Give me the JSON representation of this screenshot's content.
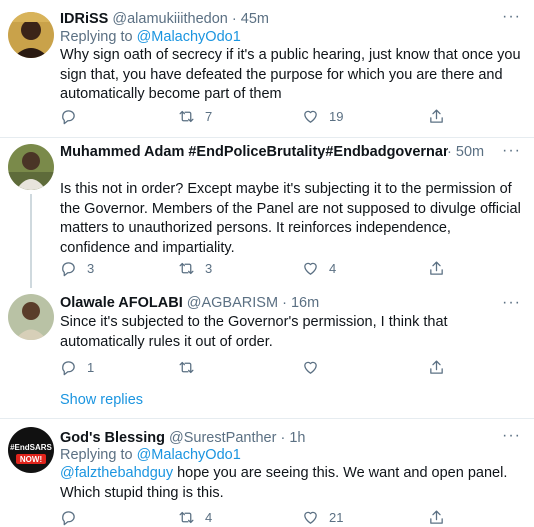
{
  "tweets": [
    {
      "name": "IDRiSS",
      "handle": "@alamukiiithedon",
      "time": "45m",
      "replying_label": "Replying to",
      "replying_to": "@MalachyOdo1",
      "text": "Why sign oath of secrecy if it's a public hearing, just know that once you sign that, you have defeated the purpose for which you are there and automatically become part of them",
      "replies": "",
      "retweets": "7",
      "likes": "19"
    },
    {
      "name": "Muhammed Adam #EndPoliceBrutality#Endbadgovernance",
      "handle": "@",
      "time": "50m",
      "text": "Is this not in order? Except maybe it's subjecting it to the permission of the Governor. Members of the Panel are not supposed to divulge official matters to unauthorized persons. It reinforces independence, confidence and impartiality.",
      "replies": "3",
      "retweets": "3",
      "likes": "4"
    },
    {
      "name": "Olawale AFOLABI",
      "handle": "@AGBARISM",
      "time": "16m",
      "text": "Since it's subjected to the Governor's permission, I think that automatically rules it out of order.",
      "replies": "1",
      "retweets": "",
      "likes": ""
    },
    {
      "name": "God's Blessing",
      "handle": "@SurestPanther",
      "time": "1h",
      "replying_label": "Replying to",
      "replying_to": "@MalachyOdo1",
      "mention": "@falzthebahdguy",
      "text": " hope you are seeing this. We want and open panel. Which stupid thing is this.",
      "replies": "",
      "retweets": "4",
      "likes": "21",
      "avatar_text_1": "#EndSARS",
      "avatar_text_2": "NOW!"
    }
  ],
  "show_replies_label": "Show replies",
  "dot": "·",
  "colors": {
    "link": "#1b95e0",
    "muted": "#5b7083",
    "divider": "#e6ecf0"
  },
  "icons": [
    "reply-icon",
    "retweet-icon",
    "like-icon",
    "share-icon",
    "more-icon"
  ]
}
